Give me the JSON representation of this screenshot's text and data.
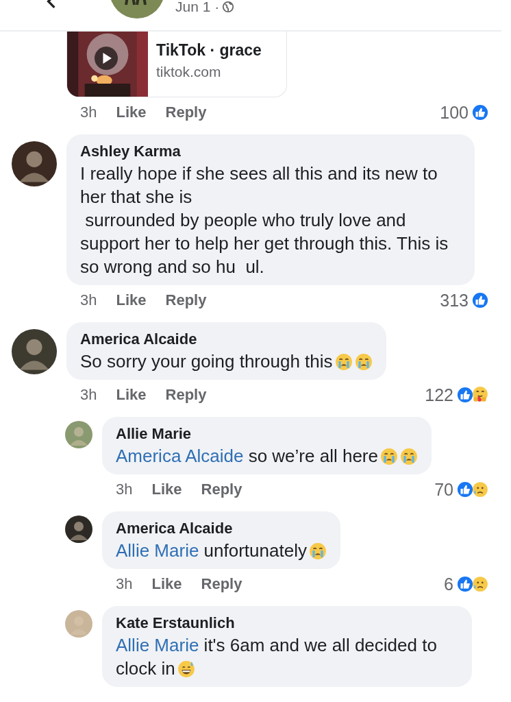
{
  "post_header": {
    "date": "Jun 1 ·"
  },
  "comments": [
    {
      "kind": "link",
      "link": {
        "title": "TikTok · grace",
        "domain": "tiktok.com"
      },
      "time": "3h",
      "like": "Like",
      "reply": "Reply",
      "count": "100",
      "reactions": [
        {
          "kind": "like"
        }
      ]
    },
    {
      "kind": "text",
      "author": "Ashley Karma",
      "lines": [
        "I really hope if she sees all this and its new to her that she is",
        " surrounded by people who truly love and support her to help her get through this. This is so wrong and so hu  ul."
      ],
      "time": "3h",
      "like": "Like",
      "reply": "Reply",
      "count": "313",
      "reactions": [
        {
          "kind": "like"
        }
      ]
    },
    {
      "kind": "text",
      "author": "America Alcaide",
      "lines": [
        "So sorry your going through this"
      ],
      "emojis": [
        {
          "kind": "crying"
        },
        {
          "kind": "crying"
        }
      ],
      "time": "3h",
      "like": "Like",
      "reply": "Reply",
      "count": "122",
      "reactions": [
        {
          "kind": "like"
        },
        {
          "kind": "care"
        }
      ],
      "children": [
        {
          "kind": "text",
          "author": "Allie Marie",
          "mention": "America Alcaide",
          "lines": [
            "so we’re all here"
          ],
          "emojis": [
            {
              "kind": "crying"
            },
            {
              "kind": "crying"
            }
          ],
          "time": "3h",
          "like": "Like",
          "reply": "Reply",
          "count": "70",
          "reactions": [
            {
              "kind": "like"
            },
            {
              "kind": "sad"
            }
          ]
        },
        {
          "kind": "text",
          "author": "America Alcaide",
          "mention": "Allie Marie",
          "lines": [
            "unfortunately"
          ],
          "emojis": [
            {
              "kind": "crying"
            }
          ],
          "time": "3h",
          "like": "Like",
          "reply": "Reply",
          "count": "6",
          "reactions": [
            {
              "kind": "like"
            },
            {
              "kind": "sad"
            }
          ]
        },
        {
          "kind": "text",
          "author": "Kate Erstaunlich",
          "mention": "Allie Marie",
          "lines": [
            "it's 6am and we all decided to clock in"
          ],
          "emojis": [
            {
              "kind": "sweat"
            }
          ]
        }
      ]
    }
  ]
}
